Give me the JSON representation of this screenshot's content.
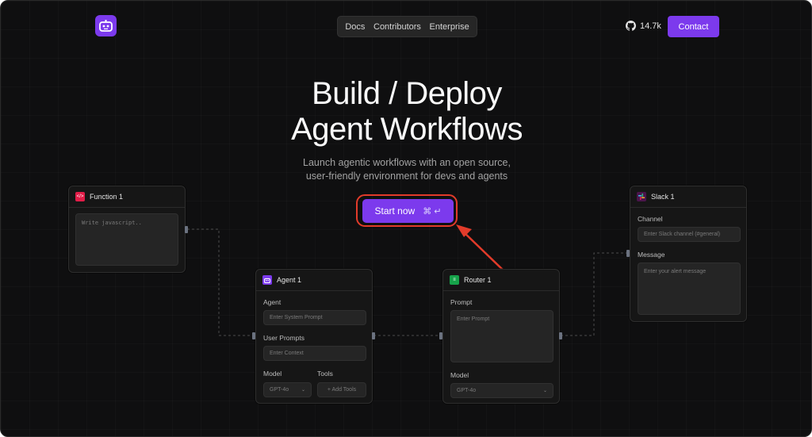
{
  "nav": {
    "items": [
      "Docs",
      "Contributors",
      "Enterprise"
    ]
  },
  "github": {
    "stars": "14.7k"
  },
  "contact_label": "Contact",
  "hero": {
    "title_line1": "Build / Deploy",
    "title_line2": "Agent Workflows",
    "subtitle_line1": "Launch agentic workflows with an open source,",
    "subtitle_line2": "user-friendly environment for devs and agents"
  },
  "start": {
    "label": "Start now",
    "shortcut": "⌘ ↵"
  },
  "function_card": {
    "title": "Function 1",
    "code_placeholder": "Write javascript.."
  },
  "agent_card": {
    "title": "Agent 1",
    "agent_label": "Agent",
    "system_prompt_placeholder": "Enter System Prompt",
    "user_prompts_label": "User Prompts",
    "context_placeholder": "Enter Context",
    "model_label": "Model",
    "model_value": "GPT-4o",
    "tools_label": "Tools",
    "add_tools_label": "+ Add Tools"
  },
  "router_card": {
    "title": "Router 1",
    "prompt_label": "Prompt",
    "prompt_placeholder": "Enter Prompt",
    "model_label": "Model",
    "model_value": "GPT-4o"
  },
  "slack_card": {
    "title": "Slack 1",
    "channel_label": "Channel",
    "channel_placeholder": "Enter Slack channel (#general)",
    "message_label": "Message",
    "message_placeholder": "Enter your alert message"
  },
  "colors": {
    "accent": "#7c3aed",
    "highlight": "#e23b2a",
    "background": "#0f0f10",
    "card": "#161616"
  }
}
